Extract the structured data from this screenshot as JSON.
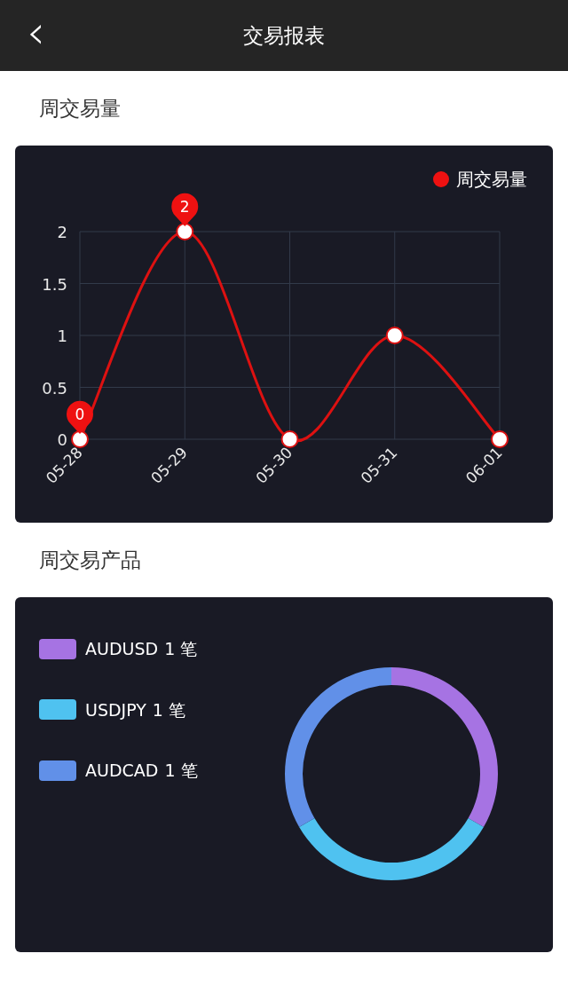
{
  "header": {
    "back_icon": "‹",
    "title": "交易报表"
  },
  "sections": [
    {
      "title": "周交易量",
      "chart_data": {
        "type": "line",
        "categories": [
          "05-28",
          "05-29",
          "05-30",
          "05-31",
          "06-01"
        ],
        "series": [
          {
            "name": "周交易量",
            "color": "#dd1111",
            "values": [
              0,
              2,
              0,
              1,
              0
            ],
            "marker": "circle"
          }
        ],
        "ylim": [
          0,
          2
        ],
        "yticks": [
          0,
          0.5,
          1,
          1.5,
          2
        ],
        "grid": true,
        "annotations": [
          {
            "x": "05-28",
            "y": 0,
            "text": "0"
          },
          {
            "x": "05-29",
            "y": 2,
            "text": "2"
          }
        ]
      }
    },
    {
      "title": "周交易产品",
      "legend": [
        {
          "count": "1 笔",
          "color": "#a673e3"
        },
        {
          "count": "1 笔",
          "color": "#4fc2f0"
        },
        {
          "count": "1 笔",
          "color": "#6190e8"
        }
      ],
      "chart_data": {
        "type": "donut",
        "categories": [
          "AUDUSD",
          "USDJPY",
          "AUDCAD"
        ],
        "values": [
          33.33,
          33.33,
          33.34
        ]
      }
    }
  ]
}
